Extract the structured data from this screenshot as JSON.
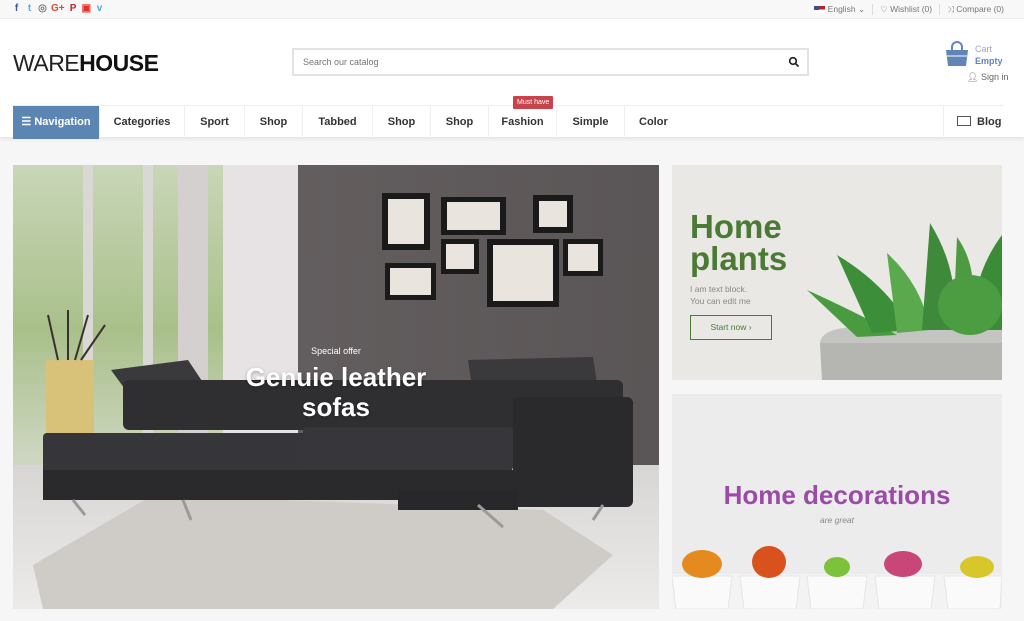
{
  "topbar": {
    "social": [
      {
        "icon": "facebook-icon",
        "glyph": "f",
        "color": "#3b5998"
      },
      {
        "icon": "twitter-icon",
        "glyph": "t",
        "color": "#55acee"
      },
      {
        "icon": "instagram-icon",
        "glyph": "◎",
        "color": "#777777"
      },
      {
        "icon": "google-plus-icon",
        "glyph": "G+",
        "color": "#dd4b39"
      },
      {
        "icon": "pinterest-icon",
        "glyph": "P",
        "color": "#cb2027"
      },
      {
        "icon": "youtube-icon",
        "glyph": "▣",
        "color": "#e52d27"
      },
      {
        "icon": "vimeo-icon",
        "glyph": "v",
        "color": "#4ea9d6"
      }
    ],
    "language": "English",
    "wishlist": "Wishlist (0)",
    "compare": "Compare (0)"
  },
  "header": {
    "logo_light": "WARE",
    "logo_bold": "HOUSE",
    "search_placeholder": "Search our catalog",
    "cart_label": "Cart",
    "cart_status": "Empty",
    "signin": "Sign in"
  },
  "nav": {
    "main": "Navigation",
    "items": [
      "Categories",
      "Sport",
      "Shop",
      "Tabbed",
      "Shop",
      "Shop",
      "Fashion",
      "Simple",
      "Color"
    ],
    "badge": "Must have",
    "blog": "Blog",
    "accent": "#5b86b4",
    "badge_color": "#c8434a"
  },
  "hero": {
    "kicker": "Special offer",
    "title_line1": "Genuie leather",
    "title_line2": "sofas"
  },
  "banner1": {
    "title_line1": "Home",
    "title_line2": "plants",
    "text_line1": "I am text block.",
    "text_line2": "You can edit me",
    "button": "Start now",
    "color": "#4a7a34"
  },
  "banner2": {
    "title": "Home decorations",
    "subtitle": "are great",
    "color": "#9b4aa8"
  }
}
